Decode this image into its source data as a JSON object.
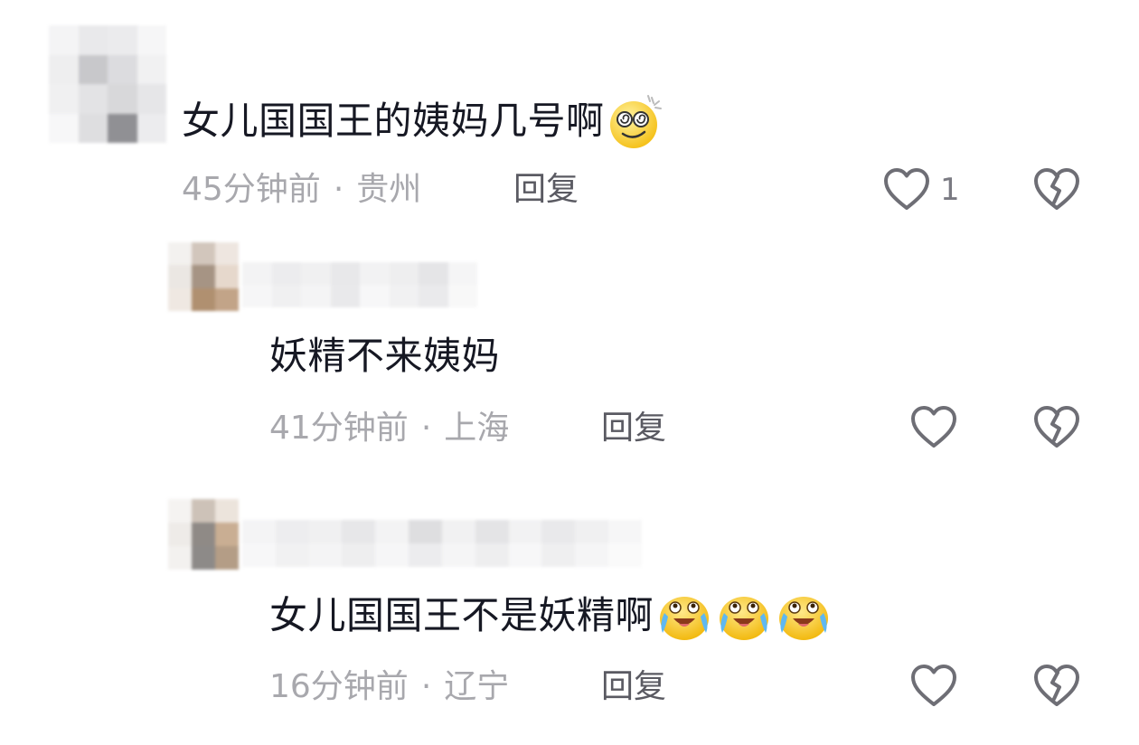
{
  "comments": [
    {
      "text": "女儿国国王的姨妈几号啊",
      "time": "45分钟前",
      "location": "贵州",
      "reply_label": "回复",
      "like_count": "1",
      "emojis": [
        "dizzy-smile-emoji"
      ]
    },
    {
      "text": "妖精不来姨妈",
      "time": "41分钟前",
      "location": "上海",
      "reply_label": "回复",
      "like_count": "",
      "emojis": []
    },
    {
      "text": "女儿国国王不是妖精啊",
      "time": "16分钟前",
      "location": "辽宁",
      "reply_label": "回复",
      "like_count": "",
      "emojis": [
        "crying-laugh-emoji",
        "crying-laugh-emoji",
        "crying-laugh-emoji"
      ]
    }
  ],
  "meta_separator": "·",
  "icons": {
    "like": "heart-outline-icon",
    "dislike": "broken-heart-icon"
  },
  "colors": {
    "text": "#161823",
    "meta": "#a8a8ad",
    "reply": "#5a5a62",
    "icon": "#6e6e75"
  }
}
